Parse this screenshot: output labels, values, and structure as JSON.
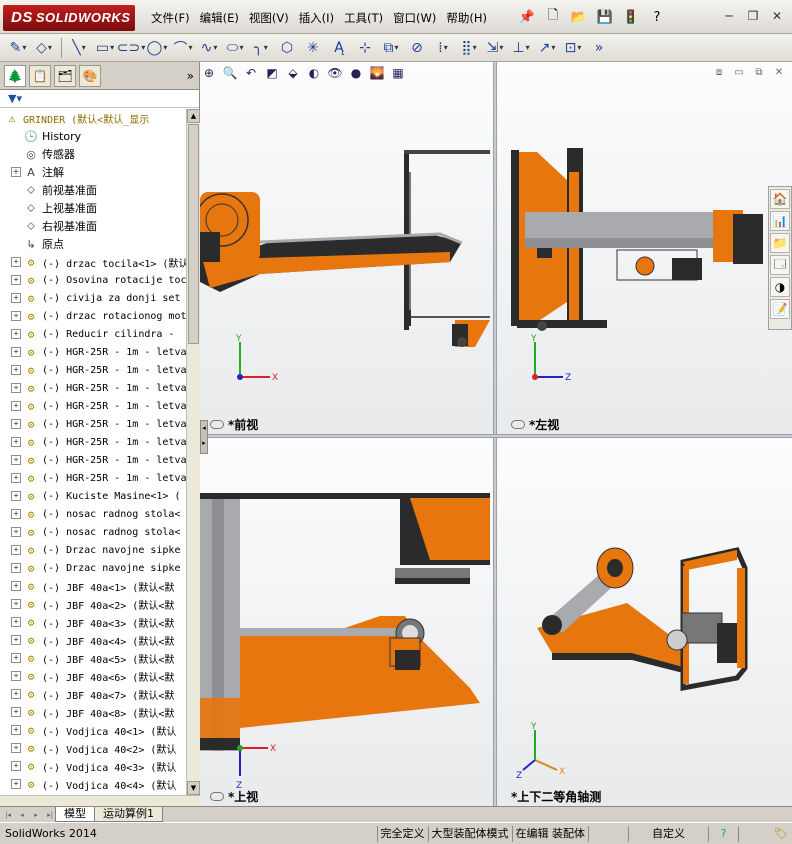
{
  "app": {
    "brand": "SOLIDWORKS",
    "brand_prefix": "DS"
  },
  "menu": [
    "文件(F)",
    "编辑(E)",
    "视图(V)",
    "插入(I)",
    "工具(T)",
    "窗口(W)",
    "帮助(H)"
  ],
  "feature_tree": {
    "root": "GRINDER  (默认<默认_显示",
    "items": [
      {
        "label": "History",
        "icon": "history-icon",
        "expand": false
      },
      {
        "label": "传感器",
        "icon": "sensor-icon",
        "expand": false
      },
      {
        "label": "注解",
        "icon": "annotation-icon",
        "expand": true
      },
      {
        "label": "前视基准面",
        "icon": "plane-icon",
        "expand": false
      },
      {
        "label": "上视基准面",
        "icon": "plane-icon",
        "expand": false
      },
      {
        "label": "右视基准面",
        "icon": "plane-icon",
        "expand": false
      },
      {
        "label": "原点",
        "icon": "origin-icon",
        "expand": false
      },
      {
        "label": "(-) drzac tocila<1> (默认",
        "icon": "part-icon",
        "expand": true
      },
      {
        "label": "(-) Osovina rotacije toc",
        "icon": "part-icon",
        "expand": true
      },
      {
        "label": "(-) civija za donji set",
        "icon": "part-icon",
        "expand": true
      },
      {
        "label": "(-) drzac rotacionog mot",
        "icon": "part-icon",
        "expand": true
      },
      {
        "label": "(-) Reducir cilindra - ",
        "icon": "part-icon",
        "expand": true
      },
      {
        "label": "(-) HGR-25R - 1m - letva",
        "icon": "part-icon",
        "expand": true
      },
      {
        "label": "(-) HGR-25R - 1m - letva",
        "icon": "part-icon",
        "expand": true
      },
      {
        "label": "(-) HGR-25R - 1m - letva",
        "icon": "part-icon",
        "expand": true
      },
      {
        "label": "(-) HGR-25R - 1m - letva",
        "icon": "part-icon",
        "expand": true
      },
      {
        "label": "(-) HGR-25R - 1m - letva",
        "icon": "part-icon",
        "expand": true
      },
      {
        "label": "(-) HGR-25R - 1m - letva",
        "icon": "part-icon",
        "expand": true
      },
      {
        "label": "(-) HGR-25R - 1m - letva",
        "icon": "part-icon",
        "expand": true
      },
      {
        "label": "(-) HGR-25R - 1m - letva",
        "icon": "part-icon",
        "expand": true
      },
      {
        "label": "(-) Kuciste Masine<1> (",
        "icon": "part-icon",
        "expand": true
      },
      {
        "label": "(-) nosac radnog stola<",
        "icon": "part-icon",
        "expand": true
      },
      {
        "label": "(-) nosac radnog stola<",
        "icon": "part-icon",
        "expand": true
      },
      {
        "label": "(-) Drzac navojne sipke",
        "icon": "part-icon",
        "expand": true
      },
      {
        "label": "(-) Drzac navojne sipke",
        "icon": "part-icon",
        "expand": true
      },
      {
        "label": "(-) JBF 40a<1> (默认<默",
        "icon": "part-icon",
        "expand": true
      },
      {
        "label": "(-) JBF 40a<2> (默认<默",
        "icon": "part-icon",
        "expand": true
      },
      {
        "label": "(-) JBF 40a<3> (默认<默",
        "icon": "part-icon",
        "expand": true
      },
      {
        "label": "(-) JBF 40a<4> (默认<默",
        "icon": "part-icon",
        "expand": true
      },
      {
        "label": "(-) JBF 40a<5> (默认<默",
        "icon": "part-icon",
        "expand": true
      },
      {
        "label": "(-) JBF 40a<6> (默认<默",
        "icon": "part-icon",
        "expand": true
      },
      {
        "label": "(-) JBF 40a<7> (默认<默",
        "icon": "part-icon",
        "expand": true
      },
      {
        "label": "(-) JBF 40a<8> (默认<默",
        "icon": "part-icon",
        "expand": true
      },
      {
        "label": "(-) Vodjica 40<1> (默认",
        "icon": "part-icon",
        "expand": true
      },
      {
        "label": "(-) Vodjica 40<2> (默认",
        "icon": "part-icon",
        "expand": true
      },
      {
        "label": "(-) Vodjica 40<3> (默认",
        "icon": "part-icon",
        "expand": true
      },
      {
        "label": "(-) Vodjica 40<4> (默认",
        "icon": "part-icon",
        "expand": true
      }
    ]
  },
  "viewports": {
    "front": {
      "label": "*前视"
    },
    "left": {
      "label": "*左视"
    },
    "top": {
      "label": "*上视"
    },
    "iso": {
      "label": "*上下二等角轴测"
    }
  },
  "axes": {
    "x": "X",
    "y": "Y",
    "z": "Z"
  },
  "bottom_tabs": [
    "模型",
    "运动算例1"
  ],
  "status": {
    "app": "SolidWorks 2014",
    "fully_defined": "完全定义",
    "large_assembly": "大型装配体模式",
    "editing": "在编辑 装配体",
    "custom": "自定义",
    "help": "?"
  },
  "colors": {
    "part_orange": "#e8760e",
    "part_gray": "#a8aaad",
    "part_dark": "#2b2b2b",
    "axis_x": "#d22",
    "axis_y": "#2a2",
    "axis_z": "#22c"
  }
}
